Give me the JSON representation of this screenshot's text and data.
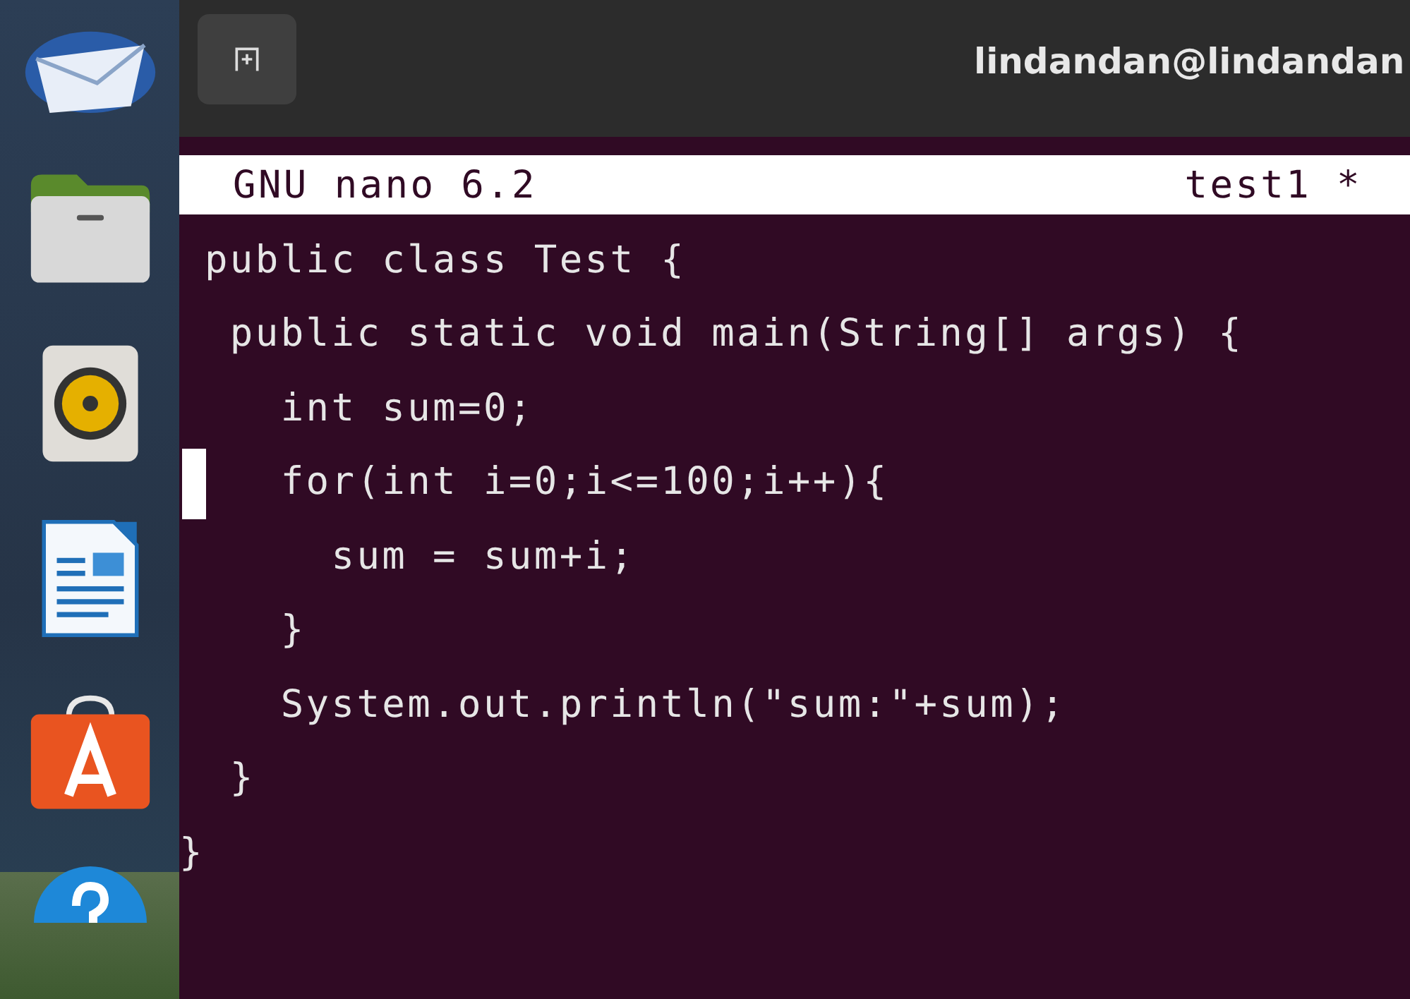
{
  "dock": {
    "apps": [
      {
        "kind": "mail"
      },
      {
        "kind": "files"
      },
      {
        "kind": "speaker"
      },
      {
        "kind": "writer"
      },
      {
        "kind": "store"
      },
      {
        "kind": "help"
      }
    ]
  },
  "window": {
    "title": "lindandan@lindandan"
  },
  "nano": {
    "header": {
      "app": "GNU nano 6.2",
      "file": "test1 *"
    },
    "lines": [
      {
        "text": " public class Test {",
        "cursor": false
      },
      {
        "text": "  public static void main(String[] args) {",
        "cursor": false
      },
      {
        "text": "    int sum=0;",
        "cursor": false
      },
      {
        "text": "    for(int i=0;i<=100;i++){",
        "cursor": true
      },
      {
        "text": "      sum = sum+i;",
        "cursor": false
      },
      {
        "text": "    }",
        "cursor": false
      },
      {
        "text": "    System.out.println(\"sum:\"+sum);",
        "cursor": false
      },
      {
        "text": "  }",
        "cursor": false
      },
      {
        "text": "}",
        "cursor": false
      }
    ]
  }
}
